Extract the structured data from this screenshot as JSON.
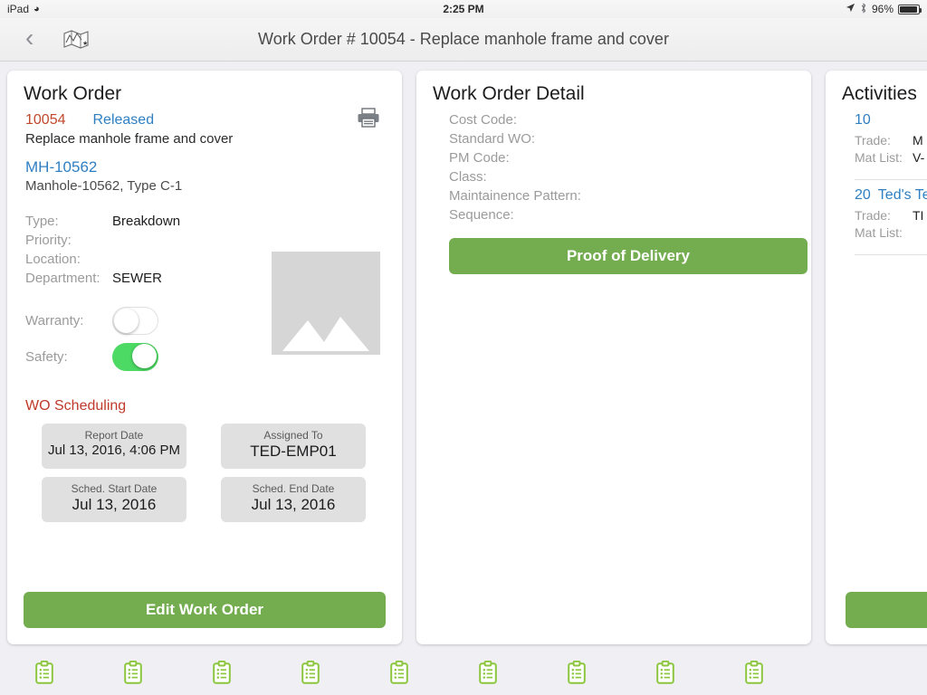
{
  "status_bar": {
    "device": "iPad",
    "wifi_icon": "wifi-icon",
    "time": "2:25 PM",
    "location_icon": "location-arrow-icon",
    "bluetooth_icon": "bluetooth-icon",
    "battery_percent": "96%"
  },
  "nav": {
    "back_icon": "chevron-left-icon",
    "map_icon": "map-icon",
    "title": "Work Order # 10054 - Replace manhole frame and cover"
  },
  "work_order": {
    "card_title": "Work Order",
    "print_icon": "printer-icon",
    "number": "10054",
    "status": "Released",
    "description": "Replace manhole frame and cover",
    "asset_id": "MH-10562",
    "asset_description": "Manhole-10562, Type C-1",
    "photo_placeholder_icon": "image-placeholder-icon",
    "fields": [
      {
        "label": "Type:",
        "value": "Breakdown"
      },
      {
        "label": "Priority:",
        "value": ""
      },
      {
        "label": "Location:",
        "value": ""
      },
      {
        "label": "Department:",
        "value": "SEWER"
      }
    ],
    "toggles": [
      {
        "label": "Warranty:",
        "state": "off"
      },
      {
        "label": "Safety:",
        "state": "on"
      }
    ],
    "scheduling_header": "WO Scheduling",
    "scheduling": [
      {
        "caption": "Report Date",
        "value": "Jul 13, 2016, 4:06 PM",
        "size": "small"
      },
      {
        "caption": "Assigned To",
        "value": "TED-EMP01",
        "size": "large"
      },
      {
        "caption": "Sched. Start Date",
        "value": "Jul 13, 2016",
        "size": "large"
      },
      {
        "caption": "Sched. End Date",
        "value": "Jul 13, 2016",
        "size": "large"
      }
    ],
    "edit_button": "Edit Work Order"
  },
  "work_order_detail": {
    "card_title": "Work Order Detail",
    "fields": [
      "Cost Code:",
      "Standard WO:",
      "PM Code:",
      "Class:",
      "Maintainence Pattern:",
      "Sequence:"
    ],
    "proof_button": "Proof of Delivery"
  },
  "activities": {
    "card_title": "Activities",
    "items": [
      {
        "seq": "10",
        "name": "",
        "trade_label": "Trade:",
        "trade_value": "M",
        "mat_label": "Mat List:",
        "mat_value": "V-"
      },
      {
        "seq": "20",
        "name": "Ted's Te",
        "trade_label": "Trade:",
        "trade_value": "TI",
        "mat_label": "Mat List:",
        "mat_value": ""
      }
    ],
    "footer_button": ""
  },
  "tab_bar": {
    "icon_name": "clipboard-icon",
    "count": 9,
    "accent_color": "#8cc63f"
  },
  "colors": {
    "green_button": "#74ad50",
    "toggle_on": "#4cd964",
    "link_blue": "#2f7fc1",
    "wo_number_orange": "#c0492c",
    "section_red": "#c0392b",
    "background": "#efeff4"
  }
}
